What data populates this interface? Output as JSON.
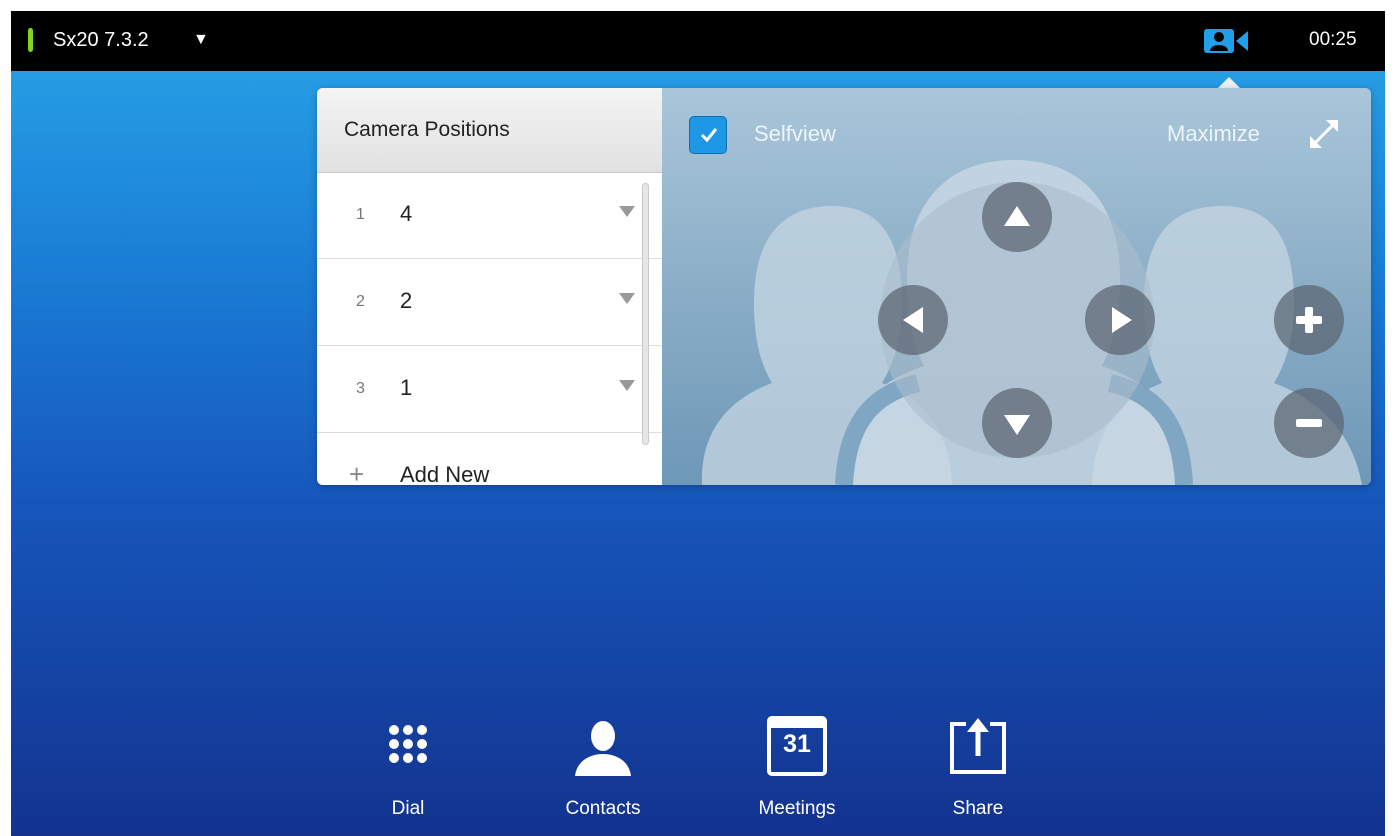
{
  "topbar": {
    "device_name": "Sx20 7.3.2",
    "caret": "▼",
    "status_color": "#7ad81f",
    "camera_icon": "camera-control-icon",
    "clock": "00:25"
  },
  "camera_panel": {
    "title": "Camera Positions",
    "presets": [
      {
        "index": "1",
        "label": "4"
      },
      {
        "index": "2",
        "label": "2"
      },
      {
        "index": "3",
        "label": "1"
      }
    ],
    "add_new": {
      "icon": "+",
      "label": "Add New"
    }
  },
  "selfview": {
    "label": "Selfview",
    "checked": true,
    "maximize_label": "Maximize"
  },
  "ptz": {
    "up": "up-arrow-icon",
    "down": "down-arrow-icon",
    "left": "left-arrow-icon",
    "right": "right-arrow-icon",
    "zoom_in": "plus-icon",
    "zoom_out": "minus-icon"
  },
  "dock": {
    "items": [
      {
        "label": "Dial",
        "icon": "keypad-icon"
      },
      {
        "label": "Contacts",
        "icon": "contact-person-icon"
      },
      {
        "label": "Meetings",
        "icon": "calendar-icon",
        "calendar_day": "31"
      },
      {
        "label": "Share",
        "icon": "share-icon"
      }
    ]
  },
  "colors": {
    "accent": "#1e97e6",
    "background_top": "#2aa6e8",
    "background_bottom": "#13338f"
  }
}
